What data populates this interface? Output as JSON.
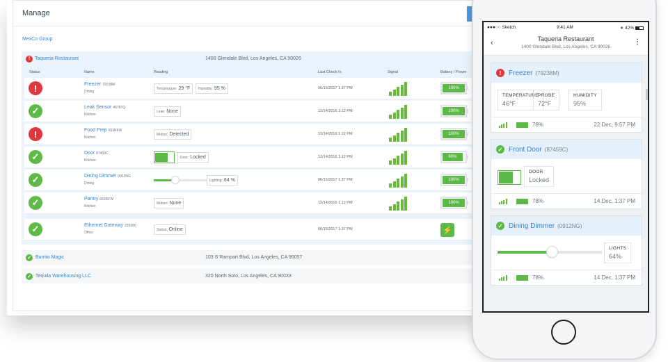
{
  "desktop": {
    "title": "Manage",
    "add_button": "Add",
    "group": "MexCo Group",
    "columns": [
      "Status",
      "Name",
      "Reading",
      "Last Check In",
      "Signal",
      "Battery / Power"
    ],
    "active_location": {
      "name": "Taqueria Restaurant",
      "address": "1400 Glendale Blvd, Los Angeles, CA 90026",
      "status": "alert"
    },
    "devices": [
      {
        "status": "alert",
        "name": "Freezer",
        "sku": "79238M",
        "room": "Dining",
        "readings": [
          {
            "label": "Temperature:",
            "value": "29 °F"
          },
          {
            "label": "Humidity:",
            "value": "95 %"
          }
        ],
        "checkin": "06/15/2017 1:37 PM",
        "signal_level": 5,
        "battery": "100%"
      },
      {
        "status": "ok",
        "name": "Leak Sensor",
        "sku": "45787Q",
        "room": "Kitchen",
        "readings": [
          {
            "label": "Leak:",
            "value": "None"
          }
        ],
        "checkin": "12/14/2016 1:12 PM",
        "signal_level": 5,
        "battery": "100%"
      },
      {
        "status": "alert",
        "name": "Food Prep",
        "sku": "653RFW",
        "room": "Kitchen",
        "readings": [
          {
            "label": "Motion:",
            "value": "Detected"
          }
        ],
        "checkin": "12/14/2016 1:12 PM",
        "signal_level": 5,
        "battery": "100%"
      },
      {
        "status": "ok",
        "name": "Door",
        "sku": "87459C",
        "room": "Kitchen",
        "readings": [
          {
            "label": "Door:",
            "value": "Locked"
          }
        ],
        "toggle": true,
        "checkin": "12/14/2016 1:12 PM",
        "signal_level": 5,
        "battery": "90%",
        "battery_level": 0.9
      },
      {
        "status": "ok",
        "name": "Dining Dimmer",
        "sku": "0912NG",
        "room": "Dining",
        "readings": [
          {
            "label": "Lighting:",
            "value": "64 %"
          }
        ],
        "slider_level": 0.64,
        "checkin": "06/15/2017 1:37 PM",
        "signal_level": 5,
        "battery": "100%"
      },
      {
        "status": "ok",
        "name": "Pantry",
        "sku": "653RFW",
        "room": "Kitchen",
        "readings": [
          {
            "label": "Motion:",
            "value": "None"
          }
        ],
        "checkin": "12/14/2016 1:12 PM",
        "signal_level": 5,
        "battery": "100%"
      },
      {
        "status": "ok",
        "name": "Ethernet Gateway",
        "sku": "235380",
        "room": "Office",
        "readings": [
          {
            "label": "Status:",
            "value": "Online"
          }
        ],
        "checkin": "06/15/2017 1:37 PM",
        "power": "wired"
      }
    ],
    "other_locations": [
      {
        "name": "Burrito Magic",
        "address": "103 S Rampart Blvd, Los Angeles, CA 90057",
        "status": "ok"
      },
      {
        "name": "Tequila Warehousing LLC",
        "address": "320 North Soto, Los Angeles, CA 90033",
        "status": "ok"
      }
    ]
  },
  "phone": {
    "status_bar": {
      "carrier": "●●●○○ Sketch",
      "time": "9:41 AM",
      "battery": "42%"
    },
    "title": "Taqueria Restaurant",
    "subtitle": "1400 Glendale Blvd, Los Angeles, CA 90026",
    "cards": [
      {
        "status": "alert",
        "name": "Freezer",
        "sku": "(79238M)",
        "metrics": [
          {
            "label": "TEMPERATURE",
            "value": "46°F"
          },
          {
            "label": "PROBE",
            "value": "72°F"
          },
          {
            "label": "HUMIDITY",
            "value": "95%"
          }
        ],
        "battery": "78%",
        "date": "22 Dec, 9:57 PM"
      },
      {
        "status": "ok",
        "name": "Front Door",
        "sku": "(87459C)",
        "metrics": [
          {
            "label": "DOOR",
            "value": "Locked"
          }
        ],
        "battery": "78%",
        "date": "14 Dec, 1:37 PM"
      },
      {
        "status": "ok",
        "name": "Dining Dimmer",
        "sku": "(0912NG)",
        "metrics": [
          {
            "label": "LIGHTS",
            "value": "64%"
          }
        ],
        "slider_level": 0.52,
        "battery": "78%",
        "date": "14 Dec, 1:37 PM"
      }
    ]
  },
  "colors": {
    "accent": "#3b82c4",
    "ok": "#5fb947",
    "alert": "#e0383e",
    "panel": "#eaf3fb"
  },
  "icons": {
    "alert": "exclamation-icon",
    "ok": "checkmark-icon",
    "power": "lightning-icon"
  }
}
